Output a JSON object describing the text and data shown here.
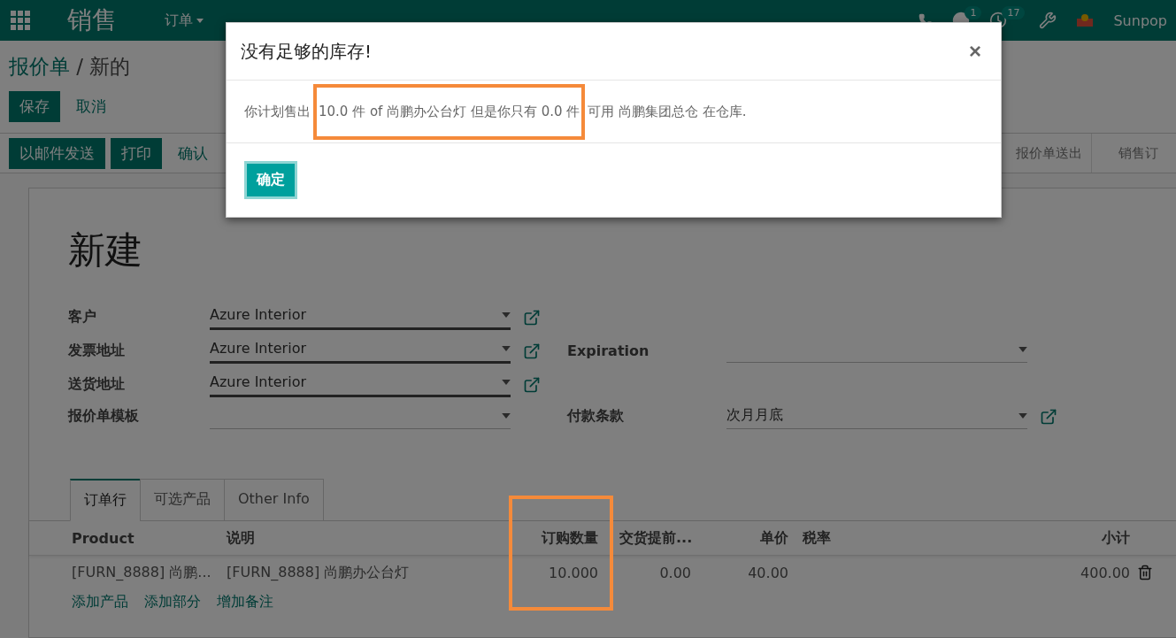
{
  "navbar": {
    "app_name": "销售",
    "menu": [
      {
        "label": "订单"
      }
    ],
    "messages_count": "1",
    "activities_count": "17",
    "user": "Sunpop"
  },
  "breadcrumb": {
    "parent": "报价单",
    "separator": "/",
    "current": "新的"
  },
  "form_buttons": [
    {
      "label": "保存",
      "kind": "primary"
    },
    {
      "label": "取消",
      "kind": "link"
    }
  ],
  "header_buttons": [
    {
      "label": "以邮件发送",
      "kind": "primary"
    },
    {
      "label": "打印",
      "kind": "primary"
    },
    {
      "label": "确认",
      "kind": "link"
    }
  ],
  "stages": [
    {
      "label": "报价单送出",
      "selected": false
    },
    {
      "label": "销售订",
      "selected": false
    }
  ],
  "title": "新建",
  "left_fields": [
    {
      "label": "客户",
      "value": "Azure Interior",
      "required": true,
      "open_link": true
    },
    {
      "label": "发票地址",
      "value": "Azure Interior",
      "required": true,
      "open_link": true
    },
    {
      "label": "送货地址",
      "value": "Azure Interior",
      "required": true,
      "open_link": true
    },
    {
      "label": "报价单模板",
      "required": false,
      "open_link": false
    }
  ],
  "right_fields": [
    {
      "label": "Expiration",
      "required": false,
      "open_link": false
    },
    {
      "label": "付款条款",
      "value": "次月月底",
      "required": false,
      "open_link": true
    }
  ],
  "tabs": [
    {
      "label": "订单行",
      "selected": true
    },
    {
      "label": "可选产品",
      "selected": false
    },
    {
      "label": "Other Info",
      "selected": false
    }
  ],
  "table": {
    "columns": [
      "Product",
      "说明",
      "订购数量",
      "交货提前...",
      "单价",
      "税率",
      "小计"
    ],
    "rows": [
      {
        "cells": [
          "[FURN_8888] 尚鹏...",
          "[FURN_8888] 尚鹏办公台灯",
          "10.000",
          "0.00",
          "40.00",
          "",
          "400.00"
        ]
      }
    ],
    "actions": [
      "添加产品",
      "添加部分",
      "增加备注"
    ]
  },
  "dialog": {
    "title": "没有足够的库存!",
    "close": "×",
    "message": {
      "before": "你计划售出",
      "highlighted": "10.0 件 of 尚鹏办公台灯 但是你只有 0.0 件",
      "after": "可用 尚鹏集团总仓 在仓库."
    },
    "ok": "确定"
  }
}
